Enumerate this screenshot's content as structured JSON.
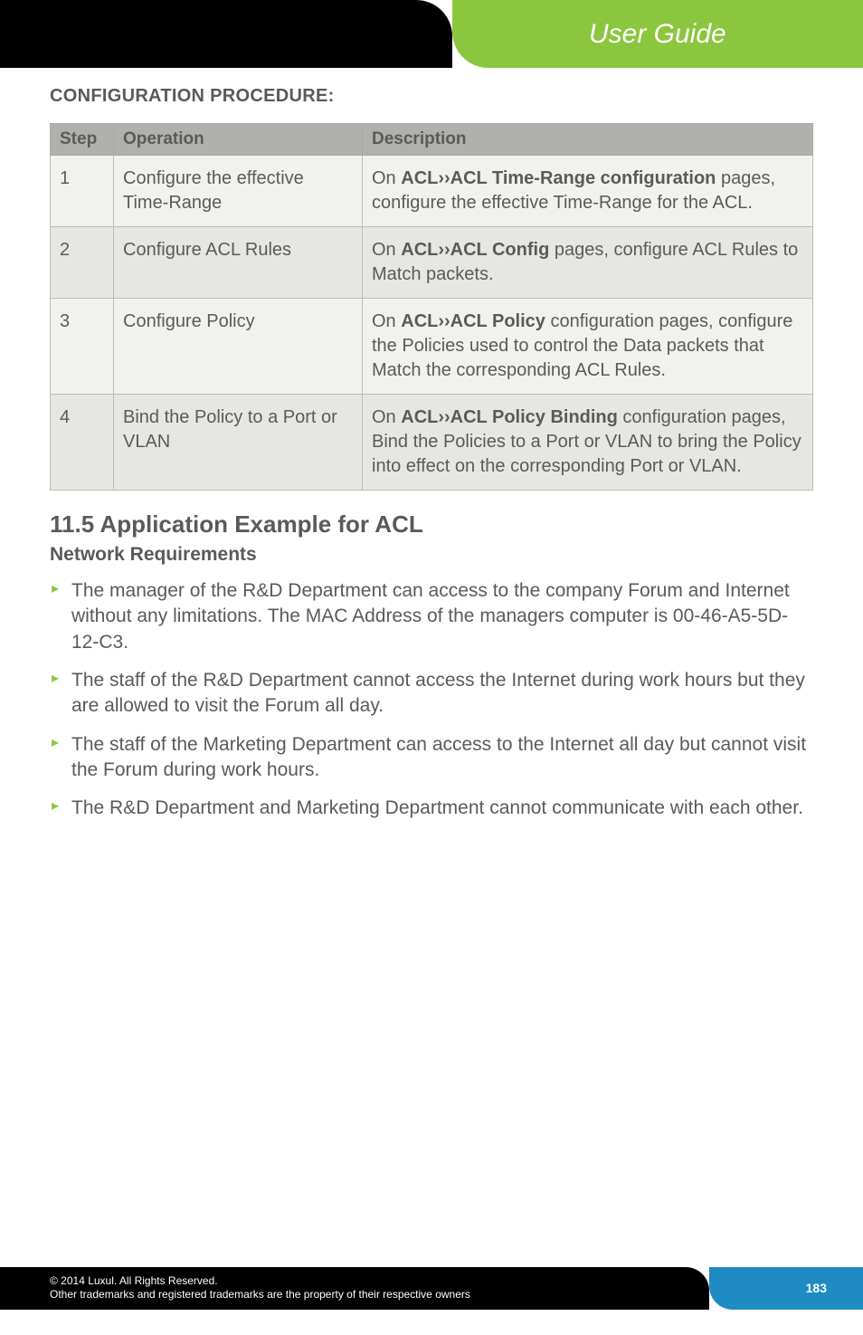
{
  "header": {
    "tab_label": "User Guide"
  },
  "cfg_procedure_heading": "CONFIGURATION PROCEDURE:",
  "table": {
    "headers": {
      "step": "Step",
      "operation": "Operation",
      "description": "Description"
    },
    "rows": [
      {
        "step": "1",
        "op": "Configure the effective Time-Range",
        "desc_pre": "On ",
        "desc_bold": "ACL››ACL Time-Range configuration",
        "desc_post": " pages, configure the effective Time-Range for the ACL."
      },
      {
        "step": "2",
        "op": "Configure ACL Rules",
        "desc_pre": "On ",
        "desc_bold": "ACL››ACL Config",
        "desc_post": " pages, configure ACL Rules to Match packets."
      },
      {
        "step": "3",
        "op": "Configure Policy",
        "desc_pre": "On ",
        "desc_bold": "ACL››ACL Policy",
        "desc_post": " configuration pages, configure the Policies used to control the Data packets that Match the corresponding ACL Rules."
      },
      {
        "step": "4",
        "op": "Bind the Policy to a Port or VLAN",
        "desc_pre": "On ",
        "desc_bold": "ACL››ACL Policy Binding",
        "desc_post": " configuration pages, Bind the Policies to a Port or VLAN to bring the Policy into effect on the corresponding Port or VLAN."
      }
    ]
  },
  "section_title": "11.5 Application Example for ACL",
  "subtitle": "Network Requirements",
  "bullets": [
    "The manager of the R&D Department can access to the company Forum and Internet without any limitations. The MAC Address of the managers computer is 00-46-A5-5D-12-C3.",
    "The staff of the R&D Department cannot access the Internet during work hours but they are allowed to visit the Forum all day.",
    "The staff of the Marketing Department can access to the Internet all day but cannot visit the Forum during work hours.",
    "The R&D Department and Marketing Department cannot communicate with each other."
  ],
  "footer": {
    "line1": "© 2014  Luxul. All Rights Reserved.",
    "line2": "Other trademarks and registered trademarks are the property of their respective owners",
    "page": "183"
  }
}
